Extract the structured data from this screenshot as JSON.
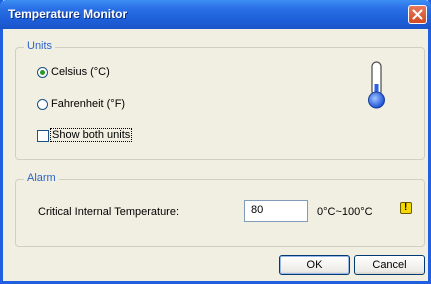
{
  "window": {
    "title": "Temperature Monitor"
  },
  "units": {
    "legend": "Units",
    "celsius_label": "Celsius (°C)",
    "fahrenheit_label": "Fahrenheit (°F)",
    "selected": "celsius",
    "show_both_label": "Show both units",
    "show_both_checked": false
  },
  "alarm": {
    "legend": "Alarm",
    "critical_label": "Critical Internal Temperature:",
    "critical_value": "80",
    "range_text": "0°C~100°C"
  },
  "buttons": {
    "ok": "OK",
    "cancel": "Cancel"
  },
  "colors": {
    "titlebar": "#2a6fe6",
    "legend": "#2e63c8",
    "background": "#f1efe2",
    "warning": "#f5d800"
  },
  "icons": [
    "close-icon",
    "thermometer-icon",
    "warning-icon"
  ]
}
